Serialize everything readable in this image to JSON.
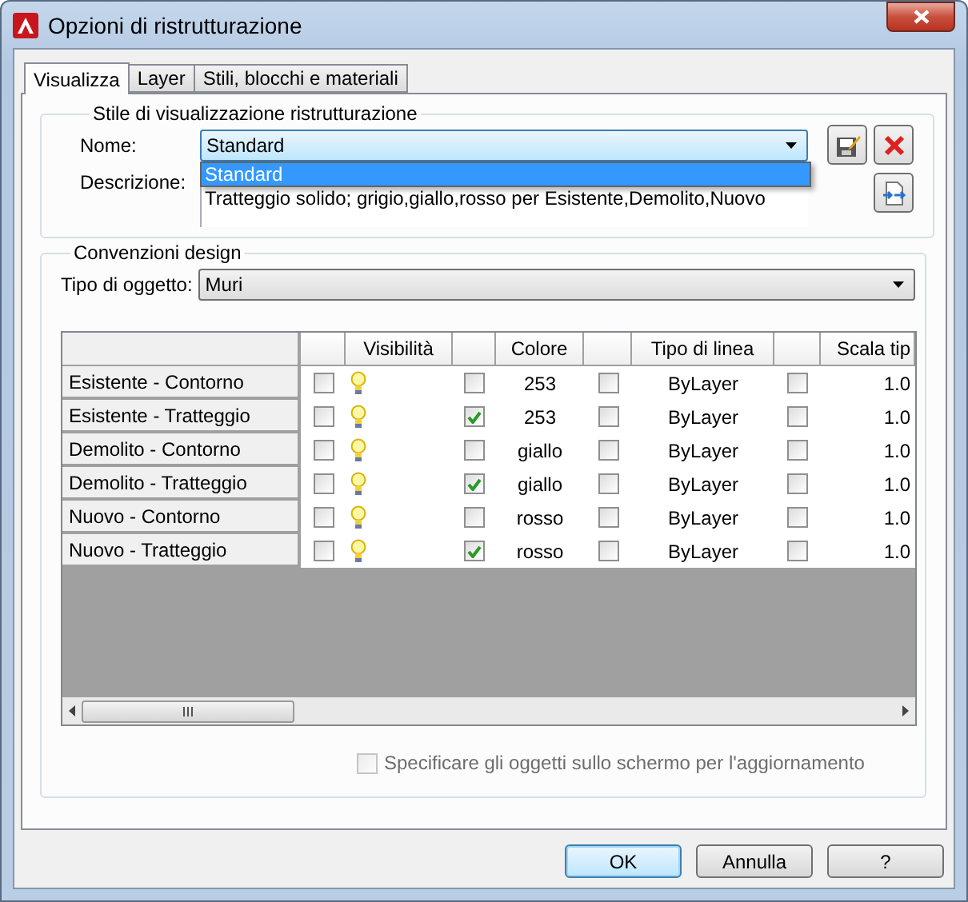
{
  "window": {
    "title": "Opzioni di ristrutturazione"
  },
  "tabs": [
    {
      "label": "Visualizza",
      "selected": true
    },
    {
      "label": "Layer",
      "selected": false
    },
    {
      "label": "Stili, blocchi e materiali",
      "selected": false
    }
  ],
  "style_group": {
    "title": "Stile di visualizzazione ristrutturazione",
    "name_label": "Nome:",
    "name_value": "Standard",
    "expanded": true,
    "options": [
      {
        "label": "Standard",
        "selected": true
      }
    ],
    "description_label": "Descrizione:",
    "description": "Tratteggio solido; grigio,giallo,rosso per Esistente,Demolito,Nuovo"
  },
  "design_group": {
    "title": "Convenzioni design",
    "object_type_label": "Tipo di oggetto:",
    "object_type": "Muri",
    "table": {
      "columns": [
        {
          "kind": "check"
        },
        {
          "kind": "text",
          "label": "Visibilità"
        },
        {
          "kind": "check"
        },
        {
          "kind": "text",
          "label": "Colore"
        },
        {
          "kind": "check"
        },
        {
          "kind": "text",
          "label": "Tipo di linea"
        },
        {
          "kind": "check"
        },
        {
          "kind": "text",
          "label": "Scala tip"
        }
      ],
      "rows": [
        {
          "name": "Esistente - Contorno",
          "cells": [
            {
              "kind": "check",
              "checked": false
            },
            {
              "kind": "bulb",
              "on": true
            },
            {
              "kind": "check",
              "checked": false
            },
            {
              "kind": "text",
              "text": "253"
            },
            {
              "kind": "check",
              "checked": false
            },
            {
              "kind": "text",
              "text": "ByLayer"
            },
            {
              "kind": "check",
              "checked": false
            },
            {
              "kind": "number",
              "text": "1.0"
            }
          ]
        },
        {
          "name": "Esistente - Tratteggio",
          "cells": [
            {
              "kind": "check",
              "checked": false
            },
            {
              "kind": "bulb",
              "on": true
            },
            {
              "kind": "check",
              "checked": true
            },
            {
              "kind": "text",
              "text": "253"
            },
            {
              "kind": "check",
              "checked": false
            },
            {
              "kind": "text",
              "text": "ByLayer"
            },
            {
              "kind": "check",
              "checked": false
            },
            {
              "kind": "number",
              "text": "1.0"
            }
          ]
        },
        {
          "name": "Demolito - Contorno",
          "cells": [
            {
              "kind": "check",
              "checked": false
            },
            {
              "kind": "bulb",
              "on": true
            },
            {
              "kind": "check",
              "checked": false
            },
            {
              "kind": "text",
              "text": "giallo"
            },
            {
              "kind": "check",
              "checked": false
            },
            {
              "kind": "text",
              "text": "ByLayer"
            },
            {
              "kind": "check",
              "checked": false
            },
            {
              "kind": "number",
              "text": "1.0"
            }
          ]
        },
        {
          "name": "Demolito - Tratteggio",
          "cells": [
            {
              "kind": "check",
              "checked": false
            },
            {
              "kind": "bulb",
              "on": true
            },
            {
              "kind": "check",
              "checked": true
            },
            {
              "kind": "text",
              "text": "giallo"
            },
            {
              "kind": "check",
              "checked": false
            },
            {
              "kind": "text",
              "text": "ByLayer"
            },
            {
              "kind": "check",
              "checked": false
            },
            {
              "kind": "number",
              "text": "1.0"
            }
          ]
        },
        {
          "name": "Nuovo - Contorno",
          "cells": [
            {
              "kind": "check",
              "checked": false
            },
            {
              "kind": "bulb",
              "on": true
            },
            {
              "kind": "check",
              "checked": false
            },
            {
              "kind": "text",
              "text": "rosso"
            },
            {
              "kind": "check",
              "checked": false
            },
            {
              "kind": "text",
              "text": "ByLayer"
            },
            {
              "kind": "check",
              "checked": false
            },
            {
              "kind": "number",
              "text": "1.0"
            }
          ]
        },
        {
          "name": "Nuovo - Tratteggio",
          "cells": [
            {
              "kind": "check",
              "checked": false
            },
            {
              "kind": "bulb",
              "on": true
            },
            {
              "kind": "check",
              "checked": true
            },
            {
              "kind": "text",
              "text": "rosso"
            },
            {
              "kind": "check",
              "checked": false
            },
            {
              "kind": "text",
              "text": "ByLayer"
            },
            {
              "kind": "check",
              "checked": false
            },
            {
              "kind": "number",
              "text": "1.0"
            }
          ]
        }
      ]
    },
    "update_option": {
      "label": "Specificare gli oggetti sullo schermo per l'aggiornamento",
      "checked": false,
      "disabled": true
    }
  },
  "buttons": [
    {
      "label": "OK",
      "default": true
    },
    {
      "label": "Annulla",
      "default": false
    },
    {
      "label": "?",
      "default": false
    }
  ]
}
